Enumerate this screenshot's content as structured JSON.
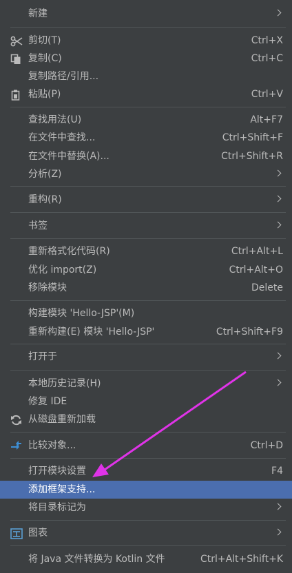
{
  "menu": {
    "new": {
      "label": "新建"
    },
    "cut": {
      "label": "剪切(T)",
      "shortcut": "Ctrl+X"
    },
    "copy": {
      "label": "复制(C)",
      "shortcut": "Ctrl+C"
    },
    "copy_path": {
      "label": "复制路径/引用..."
    },
    "paste": {
      "label": "粘贴(P)",
      "shortcut": "Ctrl+V"
    },
    "find_usages": {
      "label": "查找用法(U)",
      "shortcut": "Alt+F7"
    },
    "find_in_files": {
      "label": "在文件中查找...",
      "shortcut": "Ctrl+Shift+F"
    },
    "replace_in_files": {
      "label": "在文件中替换(A)...",
      "shortcut": "Ctrl+Shift+R"
    },
    "analyze": {
      "label": "分析(Z)"
    },
    "refactor": {
      "label": "重构(R)"
    },
    "bookmarks": {
      "label": "书签"
    },
    "reformat": {
      "label": "重新格式化代码(R)",
      "shortcut": "Ctrl+Alt+L"
    },
    "optimize_imports": {
      "label": "优化 import(Z)",
      "shortcut": "Ctrl+Alt+O"
    },
    "remove_module": {
      "label": "移除模块",
      "shortcut": "Delete"
    },
    "build_module": {
      "label": "构建模块 'Hello-JSP'(M)"
    },
    "rebuild_module": {
      "label": "重新构建(E) 模块 'Hello-JSP'",
      "shortcut": "Ctrl+Shift+F9"
    },
    "open_in": {
      "label": "打开于"
    },
    "local_history": {
      "label": "本地历史记录(H)"
    },
    "repair_ide": {
      "label": "修复 IDE"
    },
    "reload_from_disk": {
      "label": "从磁盘重新加载"
    },
    "compare_with": {
      "label": "比较对象...",
      "shortcut": "Ctrl+D"
    },
    "open_module_settings": {
      "label": "打开模块设置",
      "shortcut": "F4"
    },
    "add_framework_support": {
      "label": "添加框架支持..."
    },
    "mark_directory_as": {
      "label": "将目录标记为"
    },
    "diagrams": {
      "label": "图表"
    },
    "convert_to_kotlin": {
      "label": "将 Java 文件转换为 Kotlin 文件",
      "shortcut": "Ctrl+Alt+Shift+K"
    }
  },
  "colors": {
    "background": "#3c3f41",
    "text": "#bbbbbb",
    "selection": "#4b6eaf",
    "separator": "#515658",
    "annotation_arrow": "#e033e8"
  }
}
